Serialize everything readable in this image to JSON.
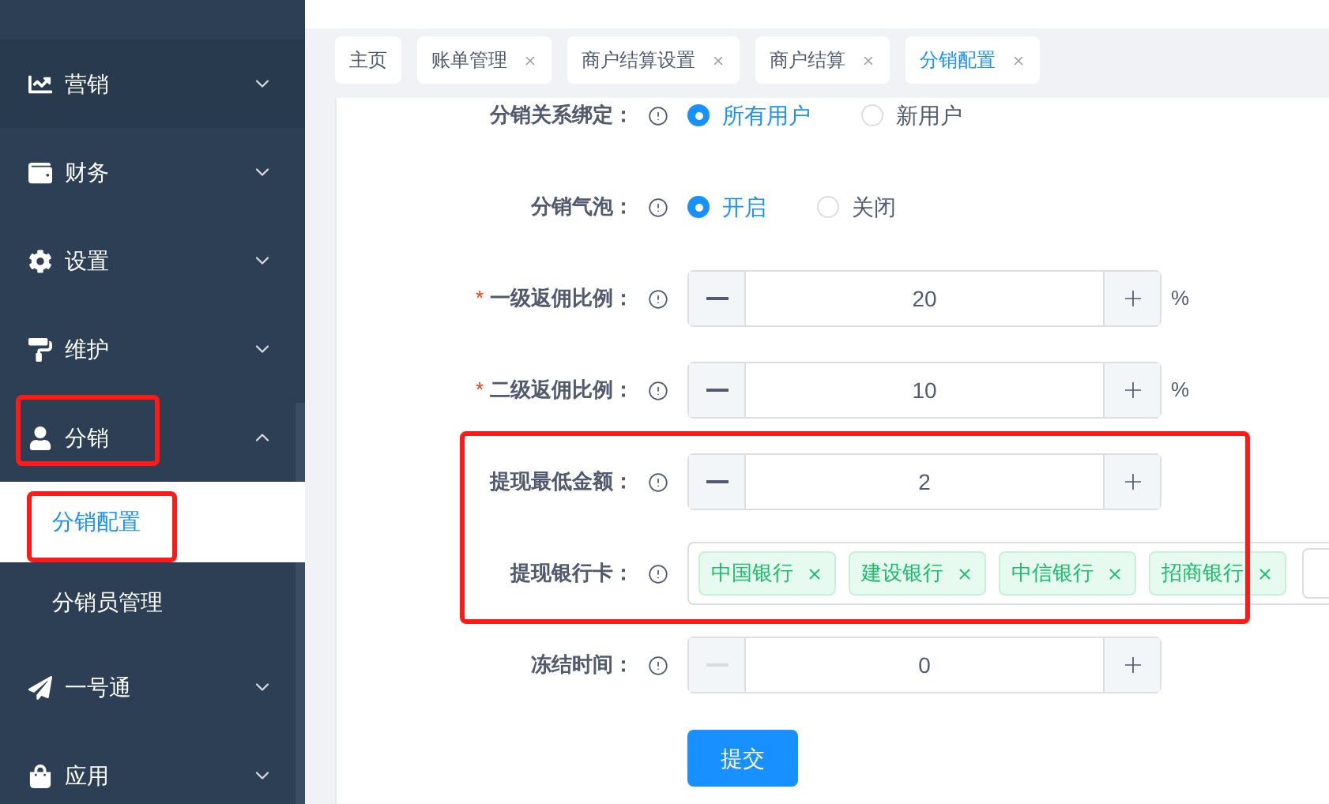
{
  "sidebar": {
    "items": [
      {
        "label": "营销",
        "expanded": false,
        "highlighted": false
      },
      {
        "label": "财务",
        "expanded": false,
        "highlighted": false
      },
      {
        "label": "设置",
        "expanded": false,
        "highlighted": false
      },
      {
        "label": "维护",
        "expanded": false,
        "highlighted": false
      },
      {
        "label": "分销",
        "expanded": true,
        "highlighted": true,
        "children": [
          {
            "label": "分销配置",
            "selected": true,
            "highlighted": true
          },
          {
            "label": "分销员管理",
            "selected": false,
            "highlighted": false
          }
        ]
      },
      {
        "label": "一号通",
        "expanded": false,
        "highlighted": false
      },
      {
        "label": "应用",
        "expanded": false,
        "highlighted": false
      }
    ]
  },
  "tabs": [
    {
      "label": "主页",
      "closable": false,
      "selected": false
    },
    {
      "label": "账单管理",
      "closable": true,
      "selected": false
    },
    {
      "label": "商户结算设置",
      "closable": true,
      "selected": false
    },
    {
      "label": "商户结算",
      "closable": true,
      "selected": false
    },
    {
      "label": "分销配置",
      "closable": true,
      "selected": true
    }
  ],
  "form": {
    "rows": [
      {
        "kind": "radio",
        "label": "分销关系绑定：",
        "highlighted": false,
        "options": [
          {
            "label": "所有用户",
            "selected": true
          },
          {
            "label": "新用户",
            "selected": false
          }
        ]
      },
      {
        "kind": "radio",
        "label": "分销气泡：",
        "highlighted": false,
        "options": [
          {
            "label": "开启",
            "selected": true
          },
          {
            "label": "关闭",
            "selected": false
          }
        ]
      },
      {
        "kind": "number",
        "required_mark": "*",
        "label": "一级返佣比例：",
        "highlighted": false,
        "value": "20",
        "unit": "%",
        "decrease_disabled": false
      },
      {
        "kind": "number",
        "required_mark": "*",
        "label": "二级返佣比例：",
        "highlighted": false,
        "value": "10",
        "unit": "%",
        "decrease_disabled": false
      },
      {
        "kind": "number",
        "label": "提现最低金额：",
        "highlighted": true,
        "value": "2",
        "decrease_disabled": false
      },
      {
        "kind": "tags",
        "label": "提现银行卡：",
        "highlighted": true,
        "tags": [
          "中国银行",
          "建设银行",
          "中信银行",
          "招商银行"
        ]
      },
      {
        "kind": "number",
        "label": "冻结时间：",
        "highlighted": false,
        "value": "0",
        "decrease_disabled": true
      }
    ],
    "submit": "提交"
  }
}
